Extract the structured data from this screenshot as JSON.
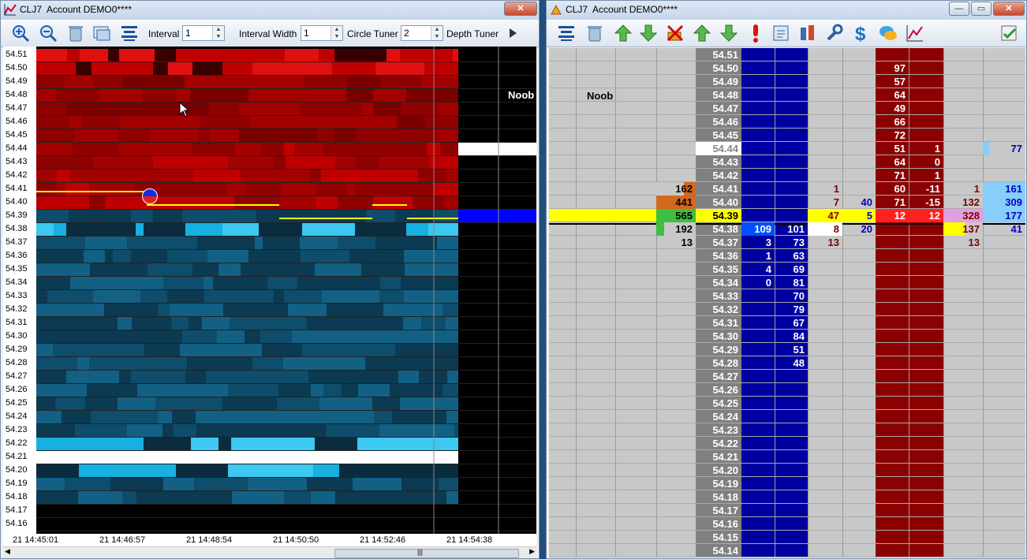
{
  "left_window": {
    "title": "CLJ7  Account DEMO0****",
    "close_glyph": "✕",
    "toolbar": {
      "interval_label": "Interval",
      "interval_value": "1",
      "interval_width_label": "Interval Width",
      "interval_width_value": "1",
      "circle_tuner_label": "Circle Tuner",
      "circle_tuner_value": "2",
      "depth_tuner_label": "Depth Tuner"
    },
    "marker_label": "Noob",
    "price_levels": [
      "54.51",
      "54.50",
      "54.49",
      "54.48",
      "54.47",
      "54.46",
      "54.45",
      "54.44",
      "54.43",
      "54.42",
      "54.41",
      "54.40",
      "54.39",
      "54.38",
      "54.37",
      "54.36",
      "54.35",
      "54.34",
      "54.33",
      "54.32",
      "54.31",
      "54.30",
      "54.29",
      "54.28",
      "54.27",
      "54.26",
      "54.25",
      "54.24",
      "54.23",
      "54.22",
      "54.21",
      "54.20",
      "54.19",
      "54.18",
      "54.17",
      "54.16"
    ],
    "time_labels": [
      "21 14:45:01",
      "21 14:46:57",
      "21 14:48:54",
      "21 14:50:50",
      "21 14:52:46",
      "21 14:54:38"
    ],
    "scroll_grip": "|||"
  },
  "right_window": {
    "title": "CLJ7  Account DEMO0****",
    "minimize_glyph": "—",
    "maximize_glyph": "▭",
    "close_glyph": "✕",
    "marker_label": "Noob",
    "prices": [
      "54.51",
      "54.50",
      "54.49",
      "54.48",
      "54.47",
      "54.46",
      "54.45",
      "54.44",
      "54.43",
      "54.42",
      "54.41",
      "54.40",
      "54.39",
      "54.38",
      "54.37",
      "54.36",
      "54.35",
      "54.34",
      "54.33",
      "54.32",
      "54.31",
      "54.30",
      "54.29",
      "54.28",
      "54.27",
      "54.26",
      "54.25",
      "54.24",
      "54.23",
      "54.22",
      "54.21",
      "54.20",
      "54.19",
      "54.18",
      "54.17",
      "54.16",
      "54.15",
      "54.14"
    ],
    "last_price": "54.39",
    "rows": {
      "54.50": {
        "ask": "97"
      },
      "54.49": {
        "ask": "57"
      },
      "54.48": {
        "ask": "64"
      },
      "54.47": {
        "ask": "49"
      },
      "54.46": {
        "ask": "66"
      },
      "54.45": {
        "ask": "72"
      },
      "54.44": {
        "ask": "51",
        "ask_delta": "1",
        "far_right": "77"
      },
      "54.43": {
        "ask": "64",
        "ask_delta": "0"
      },
      "54.42": {
        "ask": "71",
        "ask_delta": "1"
      },
      "54.41": {
        "vol": "162",
        "sell": "1",
        "ask": "60",
        "ask_delta": "-11",
        "right1": "1",
        "far_right": "161"
      },
      "54.40": {
        "vol": "441",
        "sell": "7",
        "buy": "40",
        "ask": "71",
        "ask_delta": "-15",
        "right1": "132",
        "far_right": "309"
      },
      "54.39": {
        "vol": "565",
        "sell": "47",
        "buy": "5",
        "ask": "12",
        "ask_delta": "12",
        "right1": "328",
        "far_right": "177"
      },
      "54.38": {
        "vol": "192",
        "bid_delta": "109",
        "bid": "101",
        "sell": "8",
        "buy": "20",
        "right1": "137",
        "far_right": "41"
      },
      "54.37": {
        "vol": "13",
        "bid_delta": "3",
        "bid": "73",
        "sell": "13",
        "right1": "13"
      },
      "54.36": {
        "bid_delta": "1",
        "bid": "63"
      },
      "54.35": {
        "bid_delta": "4",
        "bid": "69"
      },
      "54.34": {
        "bid_delta": "0",
        "bid": "81"
      },
      "54.33": {
        "bid": "70"
      },
      "54.32": {
        "bid": "79"
      },
      "54.31": {
        "bid": "67"
      },
      "54.30": {
        "bid": "84"
      },
      "54.29": {
        "bid": "51"
      },
      "54.28": {
        "bid": "48"
      }
    }
  },
  "colors": {
    "ask_red": "#8b0000",
    "bid_blue": "#0000a0",
    "price_gray": "#7a7a7a",
    "highlight_yellow": "#ffff00",
    "last_green": "#3fbf3f",
    "heat_cyan": "#3cb4e6"
  }
}
